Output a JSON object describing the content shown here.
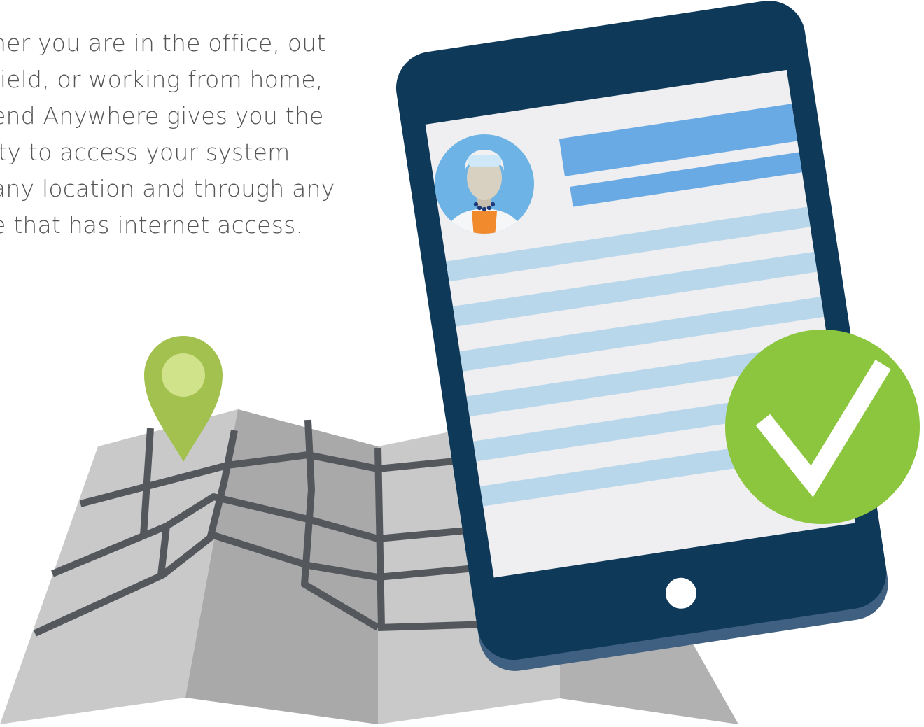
{
  "intro": {
    "lines": [
      "her you are in the office, out",
      "field, or working from home,",
      "end Anywhere gives you the",
      "ity to access your system",
      "any location and through any",
      "e that has internet access."
    ]
  },
  "colors": {
    "text": "#555555",
    "tablet_frame": "#0e3959",
    "tablet_shadow": "#3f6080",
    "screen": "#efeef0",
    "header_bar": "#6aaae4",
    "content_line": "#b9d7eb",
    "check_badge": "#8cc63f",
    "map_light": "#c9c9c9",
    "map_dark": "#a8a8a8",
    "map_road": "#54575c",
    "pin": "#a2c14e",
    "pin_dot": "#d0e38a"
  },
  "icons": {
    "map": "folded-map-icon",
    "pin": "location-pin-icon",
    "tablet": "tablet-icon",
    "avatar": "user-avatar-icon",
    "check": "checkmark-icon"
  }
}
